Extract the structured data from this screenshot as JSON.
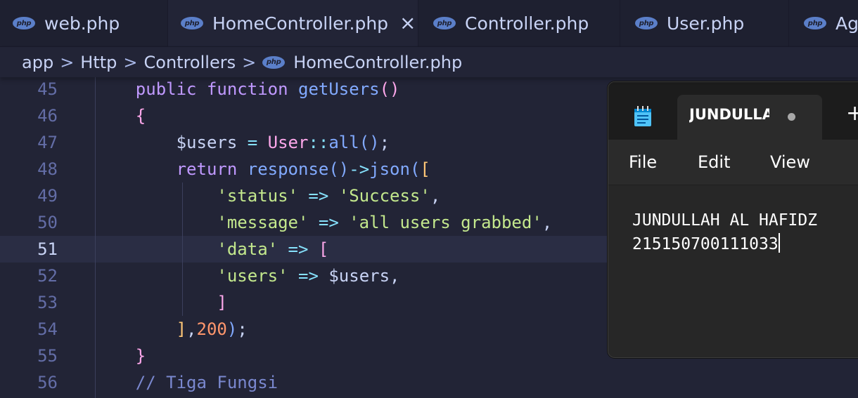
{
  "tabs": [
    {
      "label": "web.php",
      "active": false
    },
    {
      "label": "HomeController.php",
      "active": true,
      "close_icon": "×"
    },
    {
      "label": "Controller.php",
      "active": false
    },
    {
      "label": "User.php",
      "active": false
    },
    {
      "label": "Ag",
      "active": false
    }
  ],
  "php_badge": "php",
  "breadcrumb": {
    "items": [
      "app",
      "Http",
      "Controllers",
      "HomeController.php"
    ],
    "separator": ">"
  },
  "editor": {
    "current_line": "51",
    "lines": [
      {
        "n": "45",
        "tokens": [
          [
            "    ",
            "pl"
          ],
          [
            "public",
            "kw"
          ],
          [
            " ",
            "pl"
          ],
          [
            "function",
            "kw"
          ],
          [
            " ",
            "pl"
          ],
          [
            "getUsers",
            "fn"
          ],
          [
            "()",
            "br2"
          ]
        ]
      },
      {
        "n": "46",
        "tokens": [
          [
            "    ",
            "pl"
          ],
          [
            "{",
            "br2"
          ]
        ]
      },
      {
        "n": "47",
        "tokens": [
          [
            "        ",
            "pl"
          ],
          [
            "$users",
            "var"
          ],
          [
            " = ",
            "op"
          ],
          [
            "User",
            "cls2"
          ],
          [
            "::",
            "op"
          ],
          [
            "all",
            "fn"
          ],
          [
            "()",
            "br3"
          ],
          [
            ";",
            "pl"
          ]
        ]
      },
      {
        "n": "48",
        "tokens": [
          [
            "        ",
            "pl"
          ],
          [
            "return",
            "kw"
          ],
          [
            " ",
            "pl"
          ],
          [
            "response",
            "fn"
          ],
          [
            "()",
            "br3"
          ],
          [
            "->",
            "op"
          ],
          [
            "json",
            "fn"
          ],
          [
            "(",
            "br3"
          ],
          [
            "[",
            "br1"
          ]
        ]
      },
      {
        "n": "49",
        "tokens": [
          [
            "            ",
            "pl"
          ],
          [
            "'status'",
            "str"
          ],
          [
            " => ",
            "op"
          ],
          [
            "'Success'",
            "str"
          ],
          [
            ",",
            "pl"
          ]
        ]
      },
      {
        "n": "50",
        "tokens": [
          [
            "            ",
            "pl"
          ],
          [
            "'message'",
            "str"
          ],
          [
            " => ",
            "op"
          ],
          [
            "'all users grabbed'",
            "str"
          ],
          [
            ",",
            "pl"
          ]
        ]
      },
      {
        "n": "51",
        "tokens": [
          [
            "            ",
            "pl"
          ],
          [
            "'data'",
            "str"
          ],
          [
            " => ",
            "op"
          ],
          [
            "[",
            "br2"
          ]
        ]
      },
      {
        "n": "52",
        "tokens": [
          [
            "            ",
            "pl"
          ],
          [
            "'users'",
            "str"
          ],
          [
            " => ",
            "op"
          ],
          [
            "$users",
            "var"
          ],
          [
            ",",
            "pl"
          ]
        ]
      },
      {
        "n": "53",
        "tokens": [
          [
            "            ",
            "pl"
          ],
          [
            "]",
            "br2"
          ]
        ]
      },
      {
        "n": "54",
        "tokens": [
          [
            "        ",
            "pl"
          ],
          [
            "]",
            "br1"
          ],
          [
            ",",
            "pl"
          ],
          [
            "200",
            "num"
          ],
          [
            ")",
            "br3"
          ],
          [
            ";",
            "pl"
          ]
        ]
      },
      {
        "n": "55",
        "tokens": [
          [
            "    ",
            "pl"
          ],
          [
            "}",
            "br2"
          ]
        ]
      },
      {
        "n": "56",
        "tokens": [
          [
            "    ",
            "pl"
          ],
          [
            "// Tiga Fungsi",
            "cmt"
          ]
        ]
      }
    ]
  },
  "notepad": {
    "app_icon": "notepad-icon",
    "tab_title": "JUNDULLAH AL HAFIDZ",
    "unsaved_indicator": "●",
    "new_tab": "+",
    "menu": [
      "File",
      "Edit",
      "View"
    ],
    "content_lines": [
      "JUNDULLAH AL HAFIDZ",
      "215150700111033"
    ]
  },
  "colors": {
    "background": "#222436",
    "keyword": "#c099ff",
    "function": "#82aaff",
    "string": "#c3e88d",
    "number": "#ff966c",
    "comment": "#7a88cf",
    "php_badge": "#5b7fc9"
  }
}
